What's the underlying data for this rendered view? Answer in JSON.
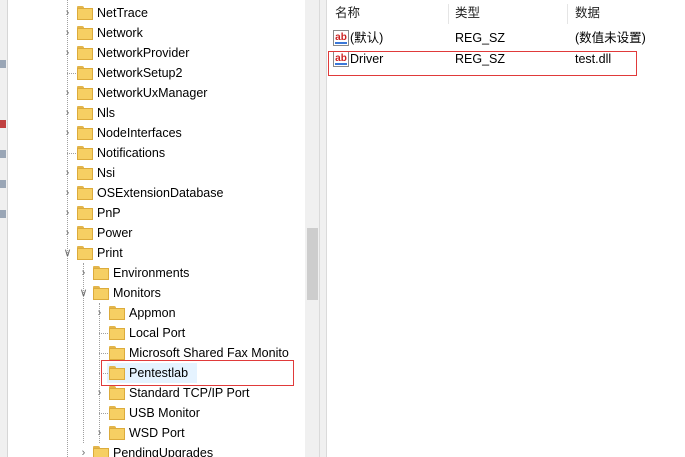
{
  "tree": {
    "items": [
      {
        "label": "NetTrace",
        "level": 0
      },
      {
        "label": "Network",
        "level": 0
      },
      {
        "label": "NetworkProvider",
        "level": 0
      },
      {
        "label": "NetworkSetup2",
        "level": 0
      },
      {
        "label": "NetworkUxManager",
        "level": 0
      },
      {
        "label": "Nls",
        "level": 0
      },
      {
        "label": "NodeInterfaces",
        "level": 0
      },
      {
        "label": "Notifications",
        "level": 0
      },
      {
        "label": "Nsi",
        "level": 0
      },
      {
        "label": "OSExtensionDatabase",
        "level": 0
      },
      {
        "label": "PnP",
        "level": 0
      },
      {
        "label": "Power",
        "level": 0
      },
      {
        "label": "Print",
        "level": 0
      },
      {
        "label": "Environments",
        "level": 1
      },
      {
        "label": "Monitors",
        "level": 1
      },
      {
        "label": "Appmon",
        "level": 2
      },
      {
        "label": "Local Port",
        "level": 2
      },
      {
        "label": "Microsoft Shared Fax Monito",
        "level": 2
      },
      {
        "label": "Pentestlab",
        "level": 2
      },
      {
        "label": "Standard TCP/IP Port",
        "level": 2
      },
      {
        "label": "USB Monitor",
        "level": 2
      },
      {
        "label": "WSD Port",
        "level": 2
      },
      {
        "label": "PendingUpgrades",
        "level": 1
      }
    ]
  },
  "list": {
    "headers": {
      "name": "名称",
      "type": "类型",
      "data": "数据"
    },
    "rows": [
      {
        "name": "(默认)",
        "type": "REG_SZ",
        "data": "(数值未设置)"
      },
      {
        "name": "Driver",
        "type": "REG_SZ",
        "data": "test.dll"
      }
    ]
  },
  "colors": {
    "selection": "#e5f3ff",
    "highlight_box": "#e03a3a",
    "folder": "#f6cf63"
  }
}
